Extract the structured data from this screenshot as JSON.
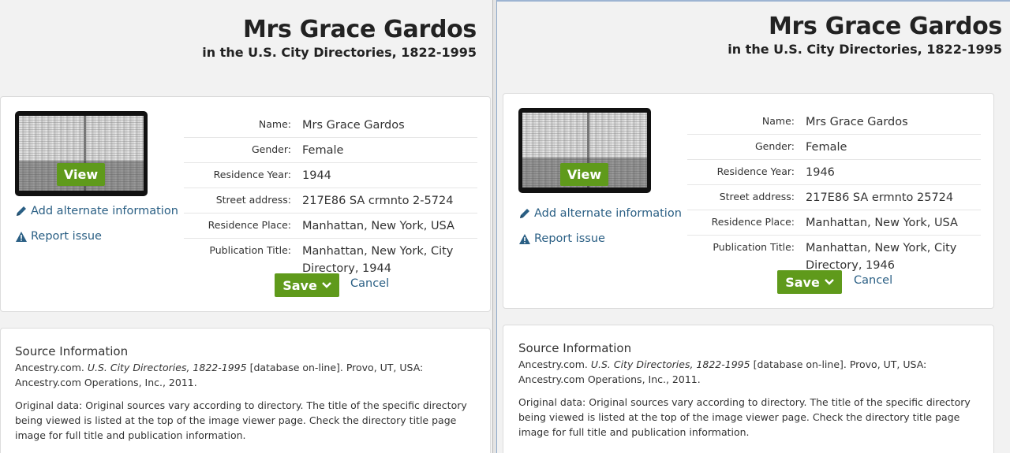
{
  "left": {
    "title": "Mrs Grace Gardos",
    "subtitle": "in the U.S. City Directories, 1822-1995",
    "view_label": "View",
    "add_alt_label": "Add alternate information",
    "report_label": "Report issue",
    "facts": [
      {
        "label": "Name:",
        "value": "Mrs Grace Gardos"
      },
      {
        "label": "Gender:",
        "value": "Female"
      },
      {
        "label": "Residence Year:",
        "value": "1944"
      },
      {
        "label": "Street address:",
        "value": "217E86 SA crmnto 2-5724"
      },
      {
        "label": "Residence Place:",
        "value": "Manhattan, New York, USA"
      },
      {
        "label": "Publication Title:",
        "value": "Manhattan, New York, City Directory, 1944"
      }
    ],
    "save_label": "Save",
    "cancel_label": "Cancel",
    "source": {
      "heading": "Source Information",
      "prefix": "Ancestry.com.",
      "db_title": "U.S. City Directories, 1822-1995",
      "suffix": "[database on-line]. Provo, UT, USA: Ancestry.com Operations, Inc., 2011.",
      "original": "Original data: Original sources vary according to directory. The title of the specific directory being viewed is listed at the top of the image viewer page. Check the directory title page image for full title and publication information."
    }
  },
  "right": {
    "title": "Mrs Grace Gardos",
    "subtitle": "in the U.S. City Directories, 1822-1995",
    "view_label": "View",
    "add_alt_label": "Add alternate information",
    "report_label": "Report issue",
    "facts": [
      {
        "label": "Name:",
        "value": "Mrs Grace Gardos"
      },
      {
        "label": "Gender:",
        "value": "Female"
      },
      {
        "label": "Residence Year:",
        "value": "1946"
      },
      {
        "label": "Street address:",
        "value": "217E86 SA ermnto 25724"
      },
      {
        "label": "Residence Place:",
        "value": "Manhattan, New York, USA"
      },
      {
        "label": "Publication Title:",
        "value": "Manhattan, New York, City Directory, 1946"
      }
    ],
    "save_label": "Save",
    "cancel_label": "Cancel",
    "source": {
      "heading": "Source Information",
      "prefix": "Ancestry.com.",
      "db_title": "U.S. City Directories, 1822-1995",
      "suffix": "[database on-line]. Provo, UT, USA: Ancestry.com Operations, Inc., 2011.",
      "original": "Original data: Original sources vary according to directory. The title of the specific directory being viewed is listed at the top of the image viewer page. Check the directory title page image for full title and publication information."
    }
  },
  "colors": {
    "accent_green": "#5f9a1b",
    "link_blue": "#2a5f84"
  },
  "icons": [
    "pencil-icon",
    "warning-icon",
    "chevron-down-icon"
  ]
}
